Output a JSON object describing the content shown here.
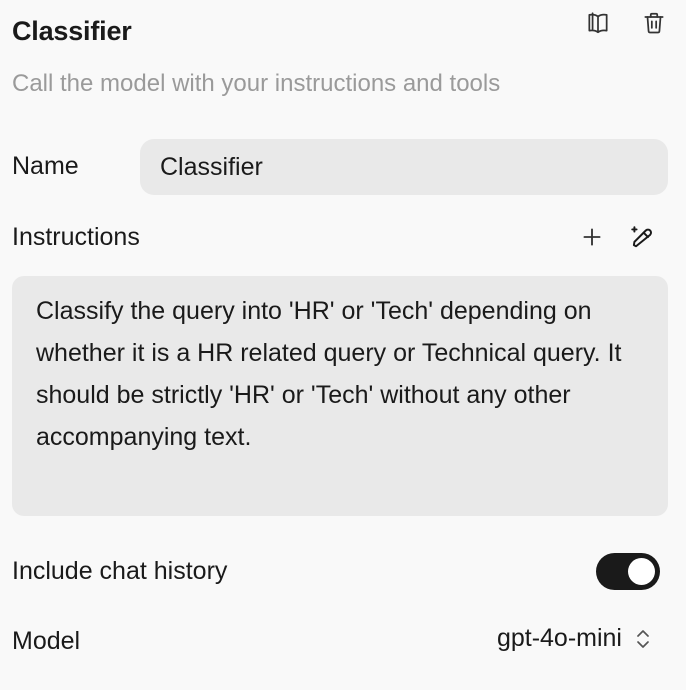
{
  "header": {
    "title": "Classifier",
    "subtitle": "Call the model with your instructions and tools",
    "actions": [
      {
        "icon": "book-icon",
        "label": "Docs"
      },
      {
        "icon": "trash-icon",
        "label": "Delete"
      }
    ]
  },
  "name": {
    "label": "Name",
    "value": "Classifier"
  },
  "instructions": {
    "label": "Instructions",
    "value": "Classify the query into 'HR' or 'Tech' depending on whether it is a HR related query or Technical query. It should be strictly 'HR' or 'Tech' without any other accompanying text.",
    "actions": [
      {
        "icon": "plus-icon"
      },
      {
        "icon": "magic-pen-icon"
      }
    ]
  },
  "chat_history": {
    "label": "Include chat history",
    "enabled": true
  },
  "model": {
    "label": "Model",
    "selected": "gpt-4o-mini"
  },
  "colors": {
    "background": "#f9f9f9",
    "input_bg": "#e9e9e9",
    "text": "#1a1a1a",
    "muted": "#9a9a9a",
    "toggle_on": "#1a1a1a"
  }
}
